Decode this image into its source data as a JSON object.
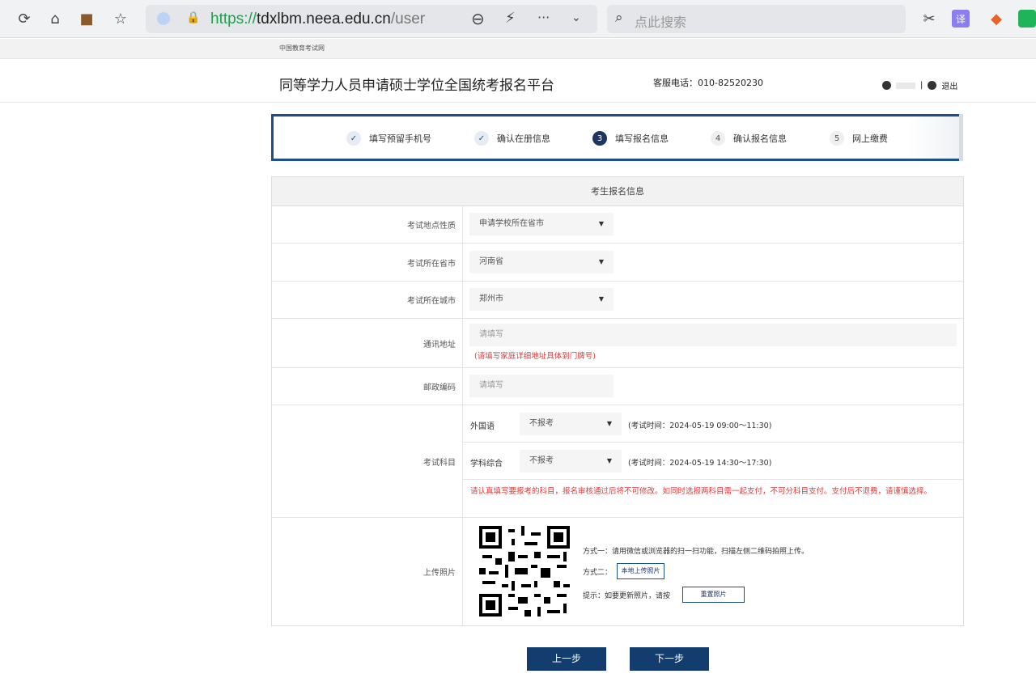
{
  "browser": {
    "url_scheme": "https://",
    "url_host": "tdxlbm.neea.edu.cn",
    "url_path": "/user",
    "search_placeholder": "点此搜索",
    "zoom": "Q",
    "more": "···"
  },
  "site": {
    "top_label": "中国教育考试网",
    "title": "同等学力人员申请硕士学位全国统考报名平台",
    "phone": "客服电话：010-82520230",
    "user_sep": "|",
    "logout": "退出"
  },
  "steps": [
    {
      "num": "✓",
      "label": "填写预留手机号",
      "state": "done"
    },
    {
      "num": "✓",
      "label": "确认在册信息",
      "state": "done"
    },
    {
      "num": "3",
      "label": "填写报名信息",
      "state": "current"
    },
    {
      "num": "4",
      "label": "确认报名信息",
      "state": "todo"
    },
    {
      "num": "5",
      "label": "网上缴费",
      "state": "todo"
    }
  ],
  "form": {
    "heading": "考生报名信息",
    "site_type_label": "考试地点性质",
    "site_type_value": "申请学校所在省市",
    "province_label": "考试所在省市",
    "province_value": "河南省",
    "city_label": "考试所在城市",
    "city_value": "郑州市",
    "address_label": "通讯地址",
    "address_placeholder": "请填写",
    "address_hint": "(请填写家庭详细地址具体到门牌号)",
    "postcode_label": "邮政编码",
    "postcode_placeholder": "请填写",
    "subjects_label": "考试科目",
    "subjects": [
      {
        "name": "外国语",
        "value": "不报考",
        "time": "(考试时间：2024-05-19 09:00～11:30)"
      },
      {
        "name": "学科综合",
        "value": "不报考",
        "time": "(考试时间：2024-05-19 14:30～17:30)"
      }
    ],
    "subjects_notice": "请认真填写要报考的科目，报名审核通过后将不可修改。如同时选报两科目需一起支付，不可分科目支付。支付后不退费，请谨慎选择。",
    "photo_label": "上传照片",
    "photo_way1": "方式一：请用微信或浏览器的扫一扫功能，扫描左侧二维码拍照上传。",
    "photo_way2": "方式二：",
    "photo_local_btn": "本地上传照片",
    "photo_tip": "提示：如要更新照片，请按",
    "photo_refresh_btn": "重置照片"
  },
  "buttons": {
    "prev": "上一步",
    "next": "下一步"
  }
}
